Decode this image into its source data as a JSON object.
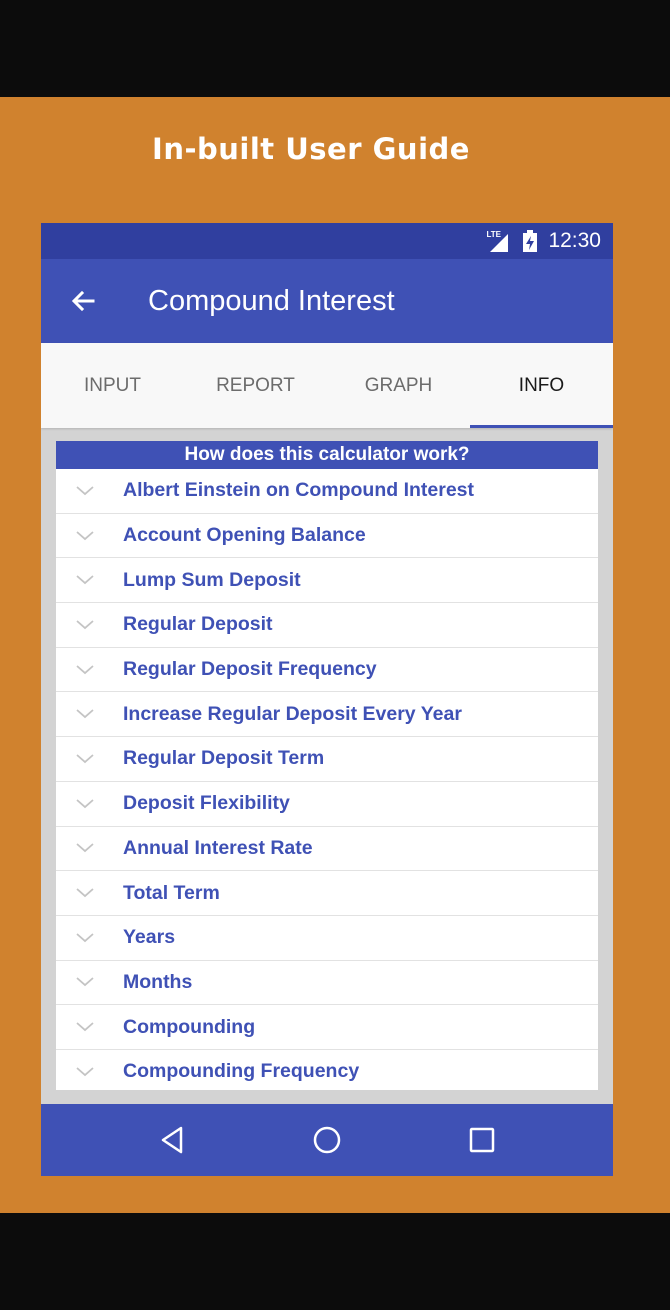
{
  "promo": {
    "title": "In-built User Guide",
    "background_color": "#d0822e"
  },
  "status_bar": {
    "network_label": "LTE",
    "time": "12:30",
    "icons": [
      "lte-signal-icon",
      "battery-charging-icon"
    ]
  },
  "app_bar": {
    "title": "Compound Interest",
    "back_icon": "arrow-back-icon",
    "color": "#3f51b5"
  },
  "tabs": [
    {
      "label": "INPUT",
      "active": false
    },
    {
      "label": "REPORT",
      "active": false
    },
    {
      "label": "GRAPH",
      "active": false
    },
    {
      "label": "INFO",
      "active": true
    }
  ],
  "info": {
    "header": "How does this calculator work?",
    "items": [
      {
        "label": "Albert Einstein on Compound Interest"
      },
      {
        "label": "Account Opening Balance"
      },
      {
        "label": "Lump Sum Deposit"
      },
      {
        "label": "Regular Deposit"
      },
      {
        "label": "Regular Deposit Frequency"
      },
      {
        "label": "Increase Regular Deposit Every Year"
      },
      {
        "label": "Regular Deposit Term"
      },
      {
        "label": "Deposit Flexibility"
      },
      {
        "label": "Annual Interest Rate"
      },
      {
        "label": "Total Term"
      },
      {
        "label": "Years"
      },
      {
        "label": "Months"
      },
      {
        "label": "Compounding"
      },
      {
        "label": "Compounding Frequency"
      }
    ]
  },
  "nav_bar": {
    "buttons": [
      "back-triangle-icon",
      "home-circle-icon",
      "recents-square-icon"
    ]
  }
}
